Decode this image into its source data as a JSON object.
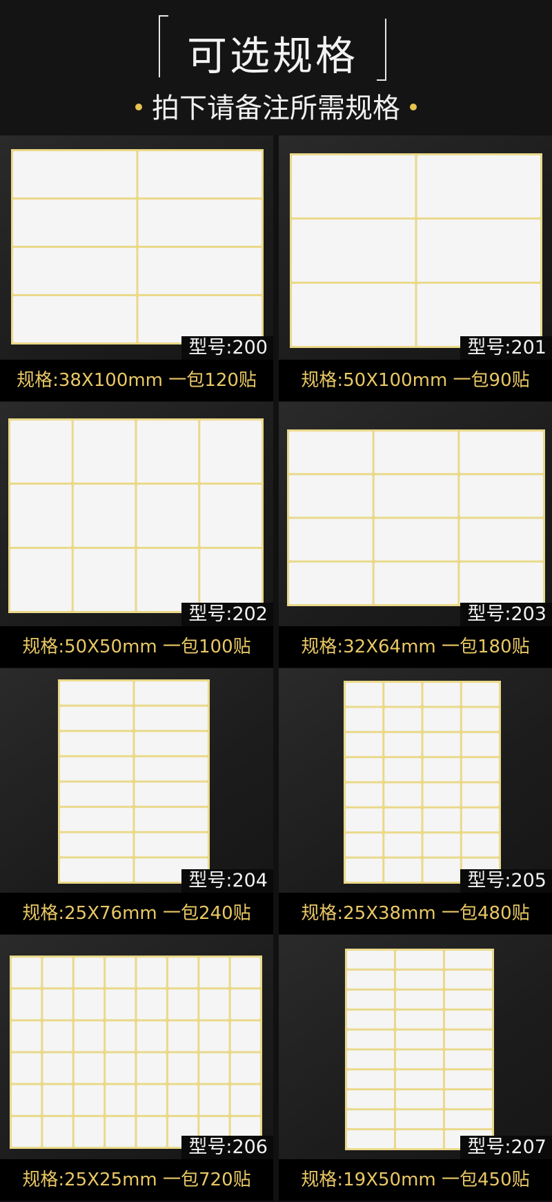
{
  "header": {
    "title": "可选规格",
    "subtitle": "拍下请备注所需规格"
  },
  "colors": {
    "background": "#111111",
    "accent_gold": "#e9c865",
    "label_white": "#f5f5f5",
    "sheet_border": "#ead98a"
  },
  "products": [
    {
      "model": "型号:200",
      "spec": "规格:38X100mm  一包120贴",
      "cols": 2,
      "rows": 4
    },
    {
      "model": "型号:201",
      "spec": "规格:50X100mm  一包90贴",
      "cols": 2,
      "rows": 3
    },
    {
      "model": "型号:202",
      "spec": "规格:50X50mm  一包100贴",
      "cols": 4,
      "rows": 3
    },
    {
      "model": "型号:203",
      "spec": "规格:32X64mm  一包180贴",
      "cols": 3,
      "rows": 4
    },
    {
      "model": "型号:204",
      "spec": "规格:25X76mm  一包240贴",
      "cols": 2,
      "rows": 8
    },
    {
      "model": "型号:205",
      "spec": "规格:25X38mm  一包480贴",
      "cols": 4,
      "rows": 8
    },
    {
      "model": "型号:206",
      "spec": "规格:25X25mm  一包720贴",
      "cols": 8,
      "rows": 6
    },
    {
      "model": "型号:207",
      "spec": "规格:19X50mm  一包450贴",
      "cols": 3,
      "rows": 10
    }
  ]
}
